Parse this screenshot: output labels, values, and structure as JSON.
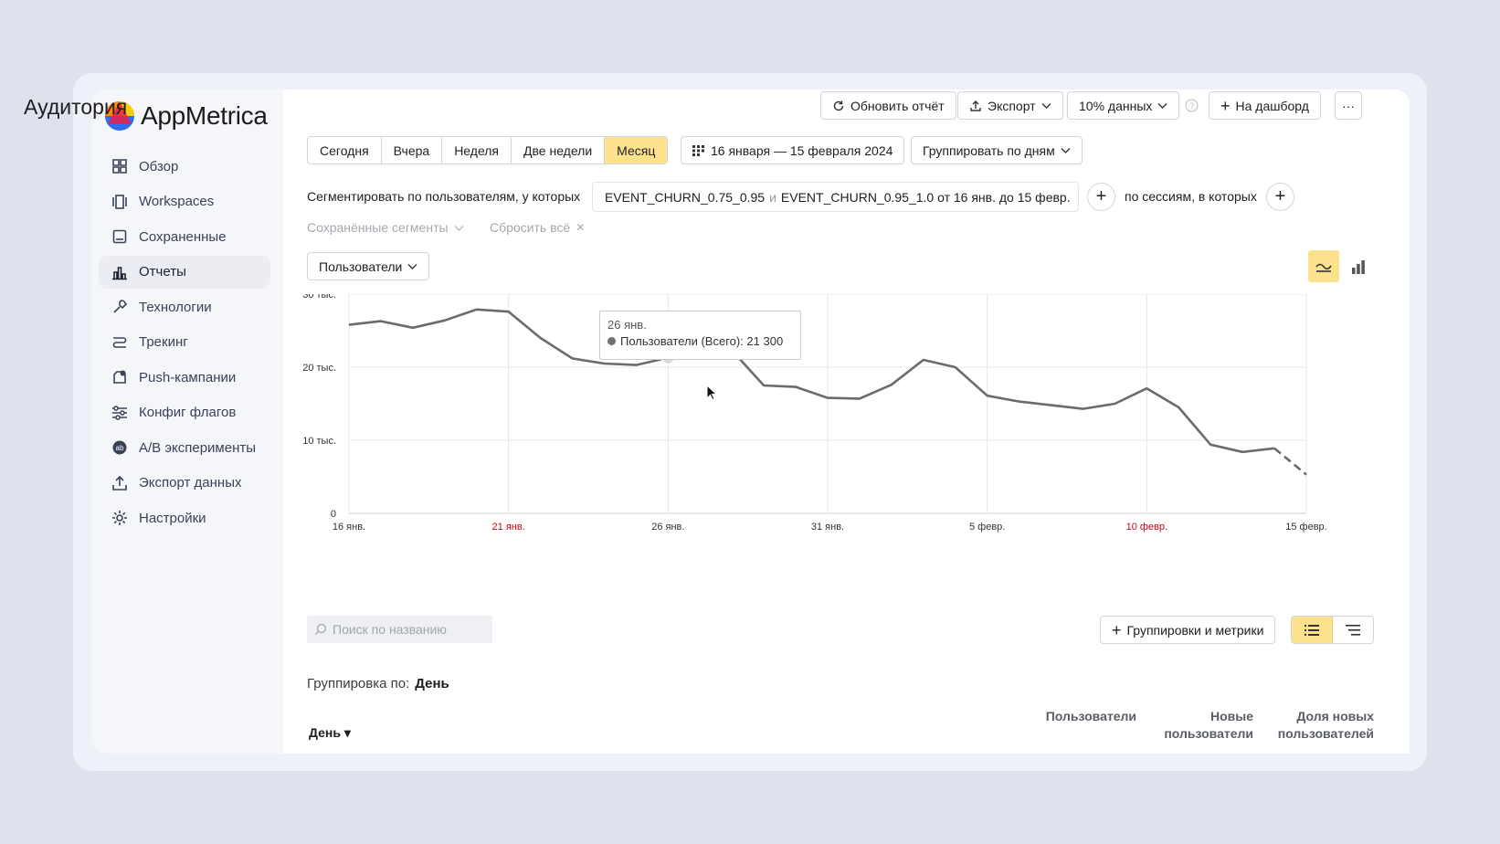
{
  "app": {
    "name": "AppMetrica"
  },
  "sidebar": {
    "items": [
      {
        "label": "Обзор",
        "icon": "grid-icon"
      },
      {
        "label": "Workspaces",
        "icon": "workspaces-icon"
      },
      {
        "label": "Сохраненные",
        "icon": "bookmark-icon"
      },
      {
        "label": "Отчеты",
        "icon": "bar-chart-icon",
        "active": true
      },
      {
        "label": "Технологии",
        "icon": "wrench-icon"
      },
      {
        "label": "Трекинг",
        "icon": "route-icon"
      },
      {
        "label": "Push-кампании",
        "icon": "push-icon"
      },
      {
        "label": "Конфиг флагов",
        "icon": "sliders-icon"
      },
      {
        "label": "A/B эксперименты",
        "icon": "ab-icon"
      },
      {
        "label": "Экспорт данных",
        "icon": "upload-icon"
      },
      {
        "label": "Настройки",
        "icon": "gear-icon"
      }
    ]
  },
  "header": {
    "title": "Аудитория",
    "refresh_label": "Обновить отчёт",
    "export_label": "Экспорт",
    "sampling_label": "10% данных",
    "dashboard_label": "На дашборд",
    "more_label": "···"
  },
  "periods": {
    "items": [
      "Сегодня",
      "Вчера",
      "Неделя",
      "Две недели",
      "Месяц"
    ],
    "active": "Месяц"
  },
  "date_range": "16 января — 15 февраля 2024",
  "grouping_select": "Группировать по дням",
  "segment": {
    "prefix": "Сегментировать по пользователям, у которых",
    "event1": "EVENT_CHURN_0.75_0.95",
    "conj": "и",
    "event2": "EVENT_CHURN_0.95_1.0 от 16 янв. до 15 февр.",
    "sessions_label": "по сессиям, в которых",
    "saved_segments": "Сохранённые сегменты",
    "reset_all": "Сбросить всё"
  },
  "metric_select": "Пользователи",
  "tooltip": {
    "date": "26 янв.",
    "series": "Пользователи (Всего): 21 300"
  },
  "chart_data": {
    "type": "line",
    "y_ticks": [
      "0",
      "10 тыс.",
      "20 тыс.",
      "30 тыс."
    ],
    "ylim": [
      0,
      30000
    ],
    "x_ticks": [
      {
        "label": "16 янв.",
        "weekend": false
      },
      {
        "label": "21 янв.",
        "weekend": true
      },
      {
        "label": "26 янв.",
        "weekend": false
      },
      {
        "label": "31 янв.",
        "weekend": false
      },
      {
        "label": "5 февр.",
        "weekend": false
      },
      {
        "label": "10 февр.",
        "weekend": true
      },
      {
        "label": "15 февр.",
        "weekend": false
      }
    ],
    "series": [
      {
        "values": [
          25800,
          26300,
          25400,
          26400,
          27900,
          27600,
          24000,
          21200,
          20500,
          20300,
          21300,
          24200,
          22300,
          17500,
          17300,
          15800,
          15700,
          17600,
          21000,
          20000,
          16100,
          15300,
          14800,
          14300,
          15000,
          17100,
          14500,
          9400,
          8400,
          8900,
          5300
        ],
        "partial_last": true
      }
    ],
    "grid": true,
    "weekend_color": "#d0021b",
    "line_color": "#6b6b6b"
  },
  "table": {
    "search_placeholder": "Поиск по названию",
    "metrics_button": "Группировки и метрики",
    "grouping_prefix": "Группировка по:",
    "grouping_value": "День",
    "day_column": "День ▾",
    "columns": [
      {
        "line1": "",
        "line2": "Пользователи"
      },
      {
        "line1": "Новые",
        "line2": "пользователи"
      },
      {
        "line1": "Доля новых",
        "line2": "пользователей"
      }
    ]
  },
  "colors": {
    "accent": "#fde28e",
    "accent_border": "#e8c862"
  }
}
